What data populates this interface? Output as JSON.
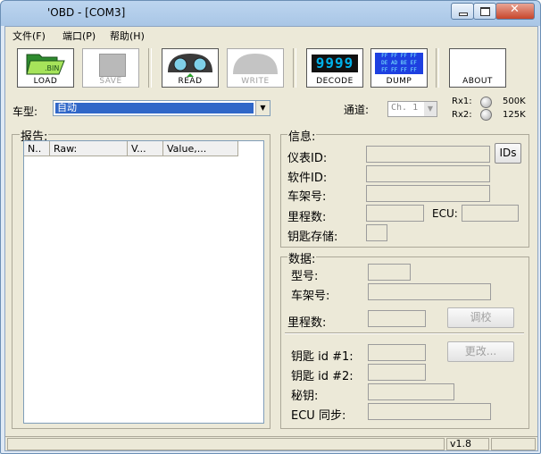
{
  "window": {
    "title": "'OBD   - [COM3]"
  },
  "menu": [
    "文件(F)",
    "端口(P)",
    "帮助(H)"
  ],
  "toolbar": {
    "load": "LOAD",
    "save": "SAVE",
    "read": "READ",
    "write": "WRITE",
    "decode": "DECODE",
    "decode_display": "9999",
    "dump": "DUMP",
    "dump_display": [
      "FF FF FF FF",
      "DE AD BE EF",
      "FF FF FF FF"
    ],
    "about": "ABOUT"
  },
  "settings": {
    "car_type_label": "车型:",
    "car_type_value": "自动",
    "channel_label": "通道:",
    "channel_value": "Ch. 1",
    "rx1_label": "Rx1:",
    "rx1_rate": "500K",
    "rx2_label": "Rx2:",
    "rx2_rate": "125K"
  },
  "report": {
    "group_label": "报告:",
    "columns": [
      "N..",
      "Raw:",
      "V...",
      "Value,..."
    ]
  },
  "info": {
    "group_label": "信息:",
    "dash_id_label": "仪表ID:",
    "ids_button": "IDs",
    "software_id_label": "软件ID:",
    "vin_label": "车架号:",
    "mileage_label": "里程数:",
    "ecu_label": "ECU:",
    "key_storage_label": "钥匙存储:"
  },
  "data": {
    "group_label": "数据:",
    "model_label": "型号:",
    "vin_label": "车架号:",
    "mileage_label": "里程数:",
    "calibrate_button": "调校",
    "key1_label": "钥匙 id #1:",
    "change_button": "更改...",
    "key2_label": "钥匙 id #2:",
    "secret_key_label": "秘钥:",
    "ecu_sync_label": "ECU 同步:"
  },
  "status": {
    "version": "v1.8"
  },
  "colors": {
    "selection": "#3067c8",
    "decode_display": "#00b0e8",
    "dump_display": "#1e40e0"
  }
}
